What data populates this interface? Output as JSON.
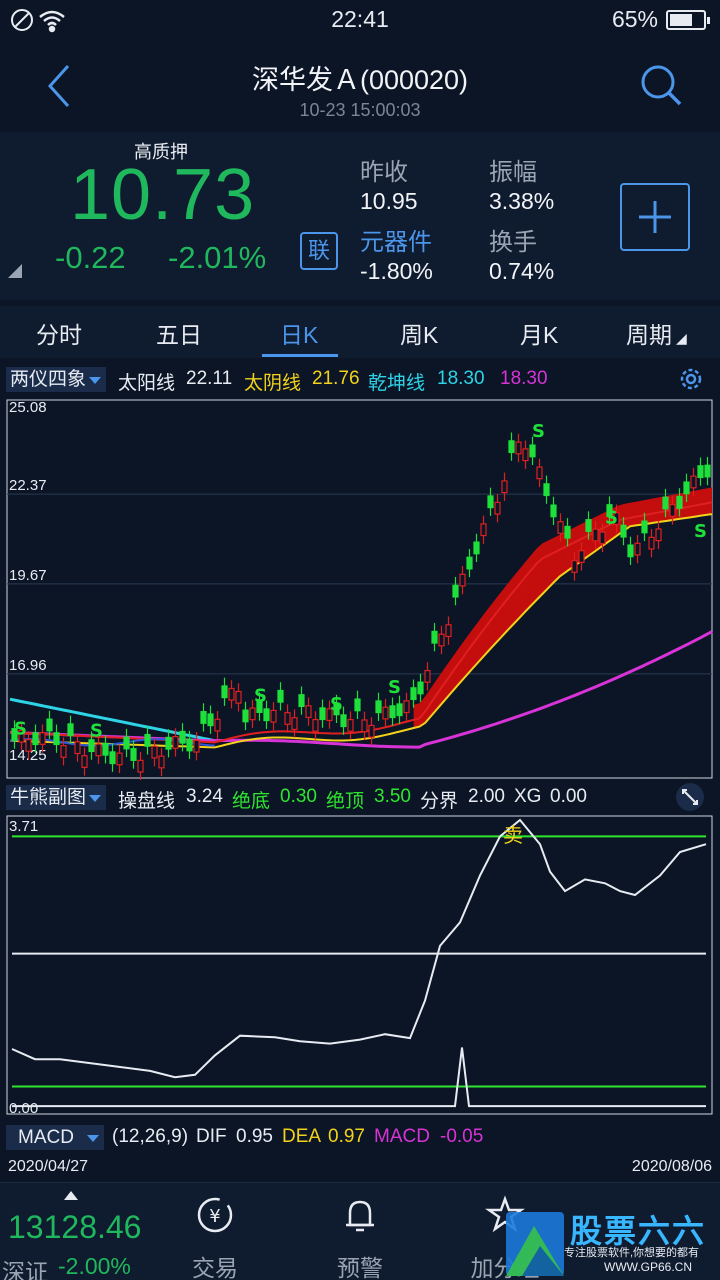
{
  "status": {
    "time": "22:41",
    "battery": "65%"
  },
  "header": {
    "title": "深华发Ａ(000020)",
    "datetime": "10-23 15:00:03"
  },
  "quote": {
    "pledge_label": "高质押",
    "price": "10.73",
    "change": "-0.22",
    "change_pct": "-2.01%",
    "lian": "联",
    "stats": [
      {
        "label": "昨收",
        "value": "10.95"
      },
      {
        "label": "振幅",
        "value": "3.38%"
      },
      {
        "label": "元器件",
        "value": "-1.80%"
      },
      {
        "label": "换手",
        "value": "0.74%"
      }
    ]
  },
  "tabs": [
    "分时",
    "五日",
    "日K",
    "周K",
    "月K",
    "周期"
  ],
  "main_indicator": {
    "name": "两仪四象",
    "sun_label": "太阳线",
    "sun_value": "22.11",
    "moon_label": "太阴线",
    "moon_value": "21.76",
    "qian_label": "乾坤线",
    "qian_value": "18.30",
    "extra_value": "18.30"
  },
  "sub_indicator": {
    "name": "牛熊副图",
    "cp_label": "操盘线",
    "cp_value": "3.24",
    "jd_label": "绝底",
    "jd_value": "0.30",
    "jt_label": "绝顶",
    "jt_value": "3.50",
    "fj_label": "分界",
    "fj_value": "2.00",
    "xg_label": "XG",
    "xg_value": "0.00",
    "sell_mark": "卖"
  },
  "macd": {
    "name": "MACD",
    "params": "(12,26,9)",
    "dif_label": "DIF",
    "dif_value": "0.95",
    "dea_label": "DEA",
    "dea_value": "0.97",
    "macd_label": "MACD",
    "macd_value": "-0.05"
  },
  "dates": {
    "start": "2020/04/27",
    "end": "2020/08/06"
  },
  "bottom": {
    "index_value": "13128.46",
    "index_name": "深证",
    "index_change": "-2.00%",
    "buttons": [
      "交易",
      "预警",
      "加分组"
    ]
  },
  "watermark": {
    "title": "股票六六",
    "subtitle": "专注股票软件,你想要的都有",
    "url": "WWW.GP66.CN"
  },
  "colors": {
    "up": "#e02020",
    "down": "#1fb85c",
    "accent": "#4b95ea",
    "sun": "#e02020",
    "moon": "#f2d21b",
    "qian": "#d733d7",
    "cyan": "#2ed3e6"
  },
  "chart_data": [
    {
      "type": "candlestick",
      "title": "两仪四象",
      "yticks": [
        25.08,
        22.37,
        19.67,
        16.96,
        14.25
      ],
      "ylim": [
        14.25,
        25.08
      ],
      "x_range": [
        "2020/04/27",
        "2020/08/06"
      ],
      "series": [
        {
          "name": "太阳线",
          "last": 22.11
        },
        {
          "name": "太阴线",
          "last": 21.76
        },
        {
          "name": "乾坤线",
          "last": 18.3
        }
      ]
    },
    {
      "type": "line",
      "title": "牛熊副图",
      "yticks": [
        3.71,
        0.0
      ],
      "ylim": [
        0.0,
        3.71
      ],
      "series": [
        {
          "name": "操盘线",
          "last": 3.24
        },
        {
          "name": "绝底",
          "value": 0.3
        },
        {
          "name": "绝顶",
          "value": 3.5
        },
        {
          "name": "分界",
          "value": 2.0
        },
        {
          "name": "XG",
          "last": 0.0
        }
      ]
    }
  ]
}
